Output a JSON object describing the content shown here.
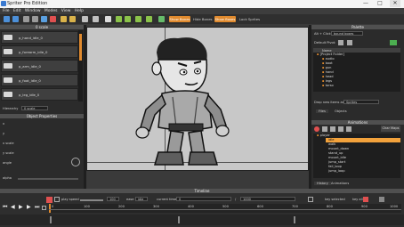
{
  "window": {
    "title": "Spriter Pro Edition",
    "minimize": "—",
    "maximize": "□",
    "close": "✕"
  },
  "menu": [
    "File",
    "Edit",
    "Window",
    "Modes",
    "View",
    "Help"
  ],
  "toolbar": {
    "bones_btn": "Show Bones",
    "boxes_btn": "Show Boxes",
    "lock_label": "Lock Sprites",
    "hide_label": "Hide Bones"
  },
  "left": {
    "header": "0 scale",
    "parts": [
      "p_hand_idle_0",
      "p_forearm_idle_0",
      "p_arm_idle_0",
      "p_foot_idle_0",
      "p_leg_idle_0"
    ],
    "hierarchy_label": "Hierarchy",
    "hierarchy_value": "0 scale",
    "props_header": "Object Properties",
    "prop_labels": [
      "x",
      "y",
      "x scale",
      "y scale",
      "angle",
      "alpha"
    ]
  },
  "palette": {
    "header": "Palette",
    "alt_click": "Alt + Click:",
    "bound_value": "bound boxes",
    "default_pivot": "Default Pivot:",
    "col_name": "Name",
    "root_folder": "[Project Folder]",
    "folders": [
      "audio",
      "boot",
      "gun",
      "hand",
      "head",
      "legs",
      "torso"
    ],
    "drop_label": "Drop new items as:",
    "drop_value": "Sprites",
    "tabs": [
      "Files",
      "Objects"
    ]
  },
  "animations": {
    "header": "Animations",
    "char_maps": "Char Maps",
    "entity": "player",
    "items": [
      "idle",
      "walk",
      "mount_down",
      "stand_up",
      "mount_idle",
      "jump_start",
      "fall_loop",
      "jump_loop"
    ],
    "selected": "idle",
    "tabs": [
      "History",
      "Animations"
    ]
  },
  "timeline": {
    "header": "Timeline",
    "play_speed_label": "play speed",
    "speed_value": "100",
    "ease_label": "ease",
    "ease_value": "idle",
    "current_time_label": "current time",
    "current_time": "0",
    "total_time": "1000",
    "key_selected": "key selected",
    "key_all": "key all",
    "ruler": [
      "0",
      "100",
      "200",
      "300",
      "400",
      "500",
      "600",
      "700",
      "800",
      "900",
      "1000"
    ]
  },
  "colors": {
    "accent": "#f2a23c",
    "panel": "#2b2b2b",
    "canvas": "#c8c8c8"
  }
}
